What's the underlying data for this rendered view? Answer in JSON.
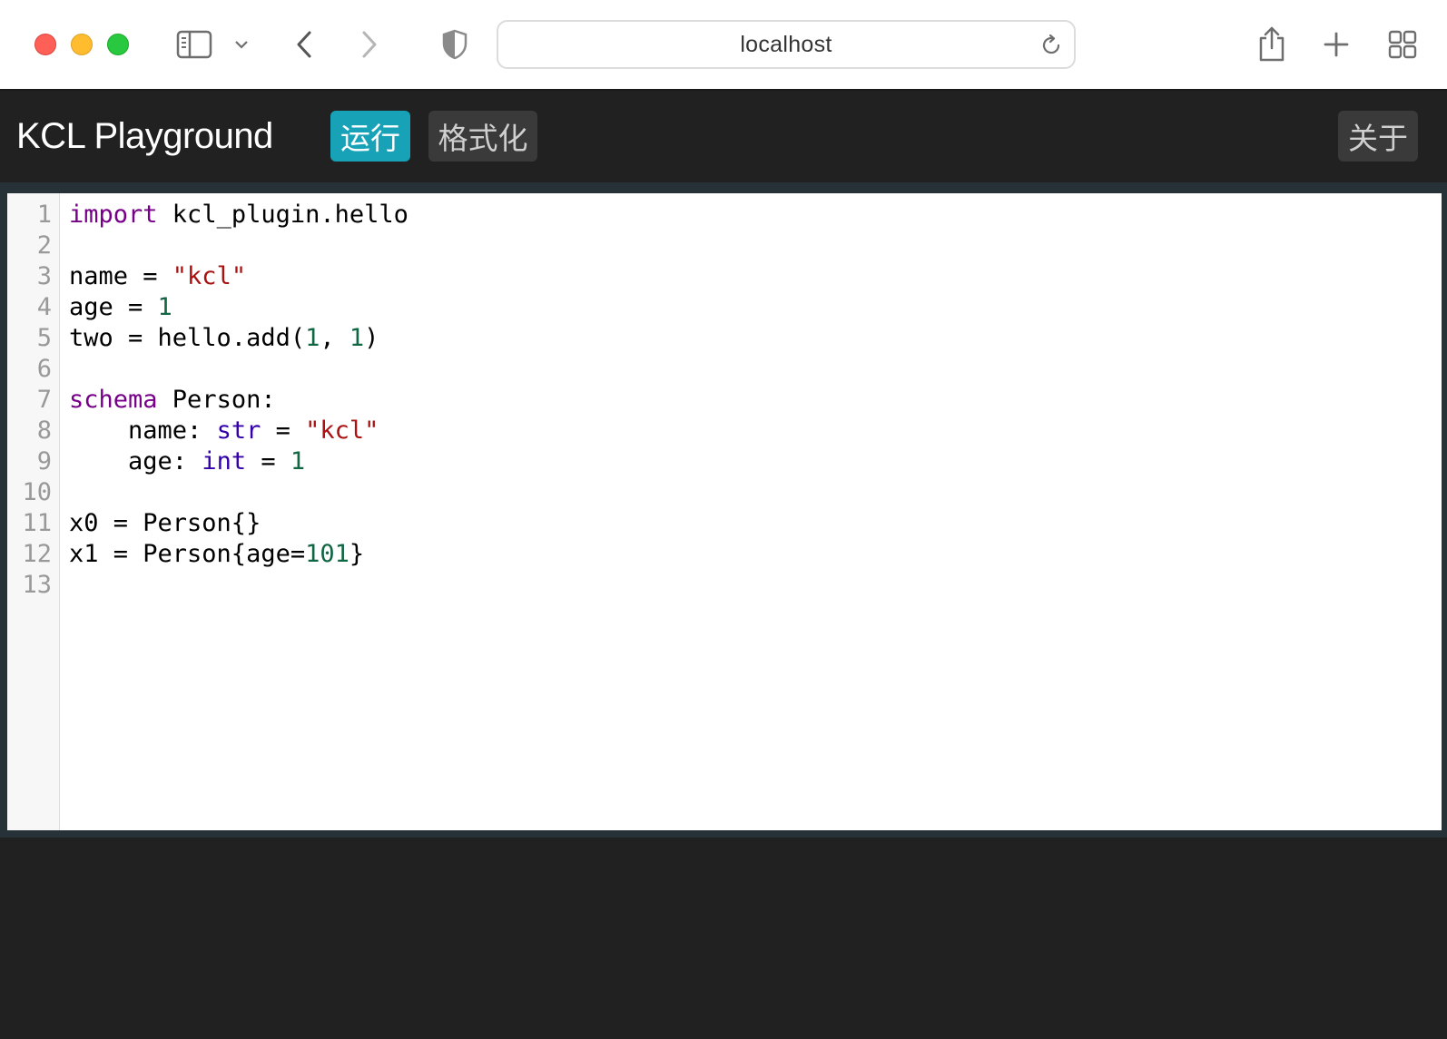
{
  "browser": {
    "url": "localhost",
    "icons": [
      "sidebar-icon",
      "chevron-down-icon",
      "back-icon",
      "forward-icon",
      "shield-icon",
      "reload-icon",
      "share-icon",
      "new-tab-icon",
      "tab-overview-icon"
    ]
  },
  "app": {
    "title": "KCL Playground",
    "run_label": "运行",
    "format_label": "格式化",
    "about_label": "关于",
    "accent_color": "#17a2b8"
  },
  "editor": {
    "line_numbers": [
      "1",
      "2",
      "3",
      "4",
      "5",
      "6",
      "7",
      "8",
      "9",
      "10",
      "11",
      "12",
      "13"
    ],
    "lines": [
      [
        {
          "t": "kw",
          "v": "import"
        },
        {
          "t": "p",
          "v": " kcl_plugin.hello"
        }
      ],
      [],
      [
        {
          "t": "p",
          "v": "name = "
        },
        {
          "t": "str",
          "v": "\"kcl\""
        }
      ],
      [
        {
          "t": "p",
          "v": "age = "
        },
        {
          "t": "num",
          "v": "1"
        }
      ],
      [
        {
          "t": "p",
          "v": "two = hello.add("
        },
        {
          "t": "num",
          "v": "1"
        },
        {
          "t": "p",
          "v": ", "
        },
        {
          "t": "num",
          "v": "1"
        },
        {
          "t": "p",
          "v": ")"
        }
      ],
      [],
      [
        {
          "t": "kw",
          "v": "schema"
        },
        {
          "t": "p",
          "v": " Person:"
        }
      ],
      [
        {
          "t": "p",
          "v": "    name: "
        },
        {
          "t": "bi",
          "v": "str"
        },
        {
          "t": "p",
          "v": " = "
        },
        {
          "t": "str",
          "v": "\"kcl\""
        }
      ],
      [
        {
          "t": "p",
          "v": "    age: "
        },
        {
          "t": "bi",
          "v": "int"
        },
        {
          "t": "p",
          "v": " = "
        },
        {
          "t": "num",
          "v": "1"
        }
      ],
      [],
      [
        {
          "t": "p",
          "v": "x0 = Person{}"
        }
      ],
      [
        {
          "t": "p",
          "v": "x1 = Person{age="
        },
        {
          "t": "num",
          "v": "101"
        },
        {
          "t": "p",
          "v": "}"
        }
      ],
      []
    ]
  }
}
